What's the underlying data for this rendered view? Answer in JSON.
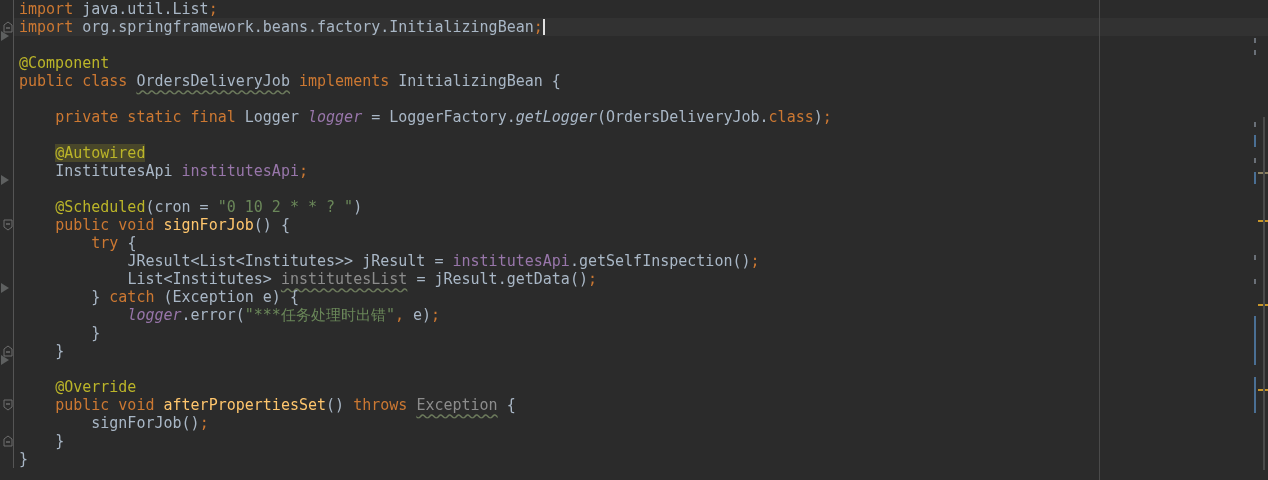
{
  "editor": {
    "lines": [
      {
        "tokens": [
          {
            "text": "import ",
            "kind": "kw"
          },
          {
            "text": "java.util.List",
            "kind": "plain"
          },
          {
            "text": ";",
            "kind": "punct"
          }
        ]
      },
      {
        "current": true,
        "fold_end": true,
        "tokens": [
          {
            "text": "import ",
            "kind": "kw"
          },
          {
            "text": "org.springframework.beans.factory.InitializingBean",
            "kind": "plain"
          },
          {
            "text": ";",
            "kind": "punct"
          }
        ]
      },
      {
        "mark": true
      },
      {
        "tokens": [
          {
            "text": "@Component",
            "kind": "ann"
          }
        ]
      },
      {
        "tokens": [
          {
            "text": "public class ",
            "kind": "kw"
          },
          {
            "text": "OrdersDeliveryJob",
            "kind": "typo"
          },
          {
            "text": " implements ",
            "kind": "kw"
          },
          {
            "text": "InitializingBean {",
            "kind": "plain"
          }
        ]
      },
      {
        "blank_before": true,
        "tokens": [
          {
            "text": "    private static final ",
            "kind": "kw"
          },
          {
            "text": "Logger ",
            "kind": "plain"
          },
          {
            "text": "logger",
            "kind": "sfield"
          },
          {
            "text": " = LoggerFactory.",
            "kind": "plain"
          },
          {
            "text": "getLogger",
            "kind": "smethod"
          },
          {
            "text": "(OrdersDeliveryJob.",
            "kind": "plain"
          },
          {
            "text": "class",
            "kind": "kw"
          },
          {
            "text": ")",
            "kind": "plain"
          },
          {
            "text": ";",
            "kind": "punct"
          }
        ]
      },
      {
        "blank_before": true,
        "tokens": [
          {
            "text": "    @Autowired",
            "kind": "annhl"
          }
        ]
      },
      {
        "tokens": [
          {
            "text": "    InstitutesApi ",
            "kind": "plain"
          },
          {
            "text": "institutesApi",
            "kind": "field"
          },
          {
            "text": ";",
            "kind": "punct"
          }
        ]
      },
      {
        "mark": true
      },
      {
        "tokens": [
          {
            "text": "    @Scheduled",
            "kind": "ann"
          },
          {
            "text": "(cron = ",
            "kind": "plain"
          },
          {
            "text": "\"0 10 2 * * ? \"",
            "kind": "str"
          },
          {
            "text": ")",
            "kind": "plain"
          }
        ]
      },
      {
        "fold_start": true,
        "tokens": [
          {
            "text": "    public void ",
            "kind": "kw"
          },
          {
            "text": "signForJob",
            "kind": "decl"
          },
          {
            "text": "() {",
            "kind": "plain"
          }
        ]
      },
      {
        "tokens": [
          {
            "text": "        try ",
            "kind": "kw"
          },
          {
            "text": "{",
            "kind": "plain"
          }
        ]
      },
      {
        "tokens": [
          {
            "text": "            JResult<List<Institutes>> jResult = ",
            "kind": "plain"
          },
          {
            "text": "institutesApi",
            "kind": "field"
          },
          {
            "text": ".getSelfInspection()",
            "kind": "plain"
          },
          {
            "text": ";",
            "kind": "punct"
          }
        ]
      },
      {
        "tokens": [
          {
            "text": "            List<Institutes> ",
            "kind": "plain"
          },
          {
            "text": "institutesList",
            "kind": "unused"
          },
          {
            "text": " = jResult.getData()",
            "kind": "plain"
          },
          {
            "text": ";",
            "kind": "punct"
          }
        ]
      },
      {
        "mark": true,
        "tokens": [
          {
            "text": "        } ",
            "kind": "plain"
          },
          {
            "text": "catch ",
            "kind": "kw"
          },
          {
            "text": "(Exception e) {",
            "kind": "plain"
          }
        ]
      },
      {
        "tokens": [
          {
            "text": "            logger",
            "kind": "sfield"
          },
          {
            "text": ".error(",
            "kind": "plain"
          },
          {
            "text": "\"***任务处理时出错\"",
            "kind": "str"
          },
          {
            "text": ", ",
            "kind": "punct"
          },
          {
            "text": "e)",
            "kind": "plain"
          },
          {
            "text": ";",
            "kind": "punct"
          }
        ]
      },
      {
        "tokens": [
          {
            "text": "        }",
            "kind": "plain"
          }
        ]
      },
      {
        "fold_end": true,
        "tokens": [
          {
            "text": "    }",
            "kind": "plain"
          }
        ]
      },
      {
        "mark": true
      },
      {
        "tokens": [
          {
            "text": "    @Override",
            "kind": "ann"
          }
        ]
      },
      {
        "fold_start": true,
        "tokens": [
          {
            "text": "    public void ",
            "kind": "kw"
          },
          {
            "text": "afterPropertiesSet",
            "kind": "decl"
          },
          {
            "text": "() ",
            "kind": "plain"
          },
          {
            "text": "throws ",
            "kind": "kw"
          },
          {
            "text": "Exception",
            "kind": "unused"
          },
          {
            "text": " {",
            "kind": "plain"
          }
        ]
      },
      {
        "tokens": [
          {
            "text": "        signForJob()",
            "kind": "plain"
          },
          {
            "text": ";",
            "kind": "punct"
          }
        ]
      },
      {
        "fold_end": true,
        "tokens": [
          {
            "text": "    }",
            "kind": "plain"
          }
        ]
      },
      {
        "tokens": [
          {
            "text": "}",
            "kind": "plain"
          }
        ]
      }
    ]
  }
}
